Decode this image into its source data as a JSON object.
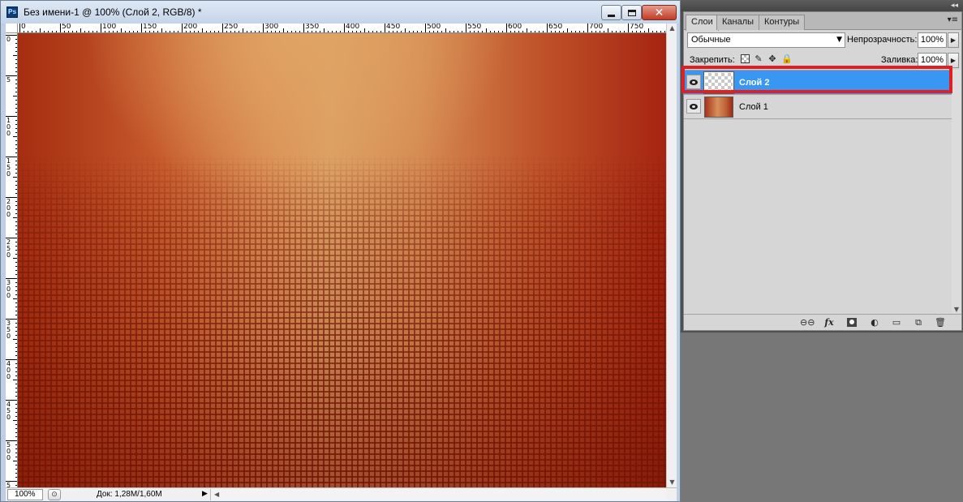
{
  "document": {
    "app_badge": "Ps",
    "title": "Без имени-1 @ 100% (Слой 2, RGB/8) *",
    "window_controls": {
      "minimize": "minimize-icon",
      "maximize": "maximize-icon",
      "close": "close-icon"
    },
    "ruler_h_labels": [
      "0",
      "50",
      "100",
      "150",
      "200",
      "250",
      "300",
      "350",
      "400",
      "450",
      "500",
      "550",
      "600",
      "650",
      "700",
      "750"
    ],
    "ruler_v_labels": [
      "0",
      "5",
      "1 0 0",
      "1 5 0",
      "2 0 0",
      "2 5 0",
      "3 0 0",
      "3 5 0",
      "4 0 0",
      "4 5 0",
      "5 0 0",
      "5"
    ],
    "status": {
      "zoom": "100%",
      "doc_info": "Док: 1,28M/1,60M"
    },
    "colors": {
      "canvas_dark": "#a52410",
      "canvas_light": "#dba063",
      "grid_lines": "#73160a"
    }
  },
  "layers_panel": {
    "tabs": [
      "Слои",
      "Каналы",
      "Контуры"
    ],
    "active_tab": "Слои",
    "blend_mode": "Обычные",
    "opacity_label": "Непрозрачность:",
    "opacity_value": "100%",
    "lock_label": "Закрепить:",
    "lock_icons": [
      "lock-transparent-icon",
      "lock-pixels-icon",
      "lock-position-icon",
      "lock-all-icon"
    ],
    "fill_label": "Заливка:",
    "fill_value": "100%",
    "layers": [
      {
        "name": "Слой 2",
        "selected": true,
        "visible": true
      },
      {
        "name": "Слой 1",
        "selected": false,
        "visible": true
      }
    ],
    "footer_icons": [
      "link-layers-icon",
      "fx-icon",
      "layer-mask-icon",
      "adjustment-layer-icon",
      "new-group-icon",
      "new-layer-icon",
      "delete-layer-icon"
    ],
    "colors": {
      "selection": "#3996f2",
      "highlight_box": "#e02020"
    }
  }
}
